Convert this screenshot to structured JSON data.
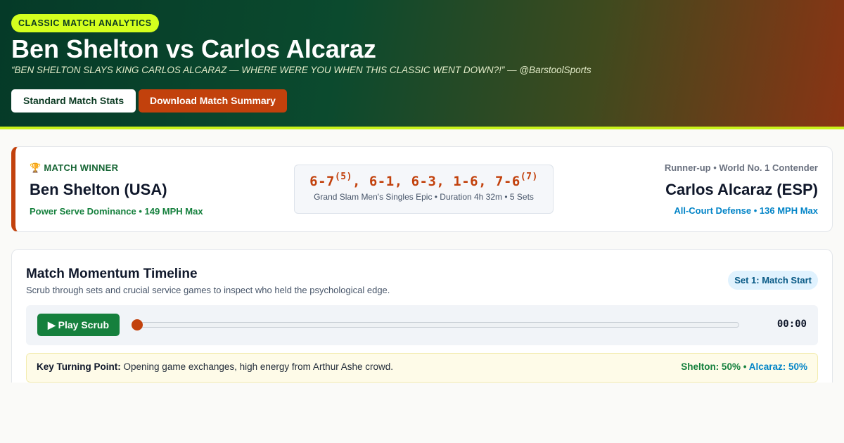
{
  "hero": {
    "badge": "CLASSIC MATCH ANALYTICS",
    "title": "Ben Shelton vs Carlos Alcaraz",
    "quote": "“BEN SHELTON SLAYS KING CARLOS ALCARAZ — WHERE WERE YOU WHEN THIS CLASSIC WENT DOWN?!” — @BarstoolSports",
    "standard_button": "Standard Match Stats",
    "download_button": "Download Match Summary"
  },
  "result": {
    "winner_tag": "🏆 MATCH WINNER",
    "winner_name": "Ben Shelton (USA)",
    "winner_note": "Power Serve Dominance • 149 MPH Max",
    "score_sets": [
      {
        "games": "6-7",
        "tiebreak": "(5)"
      },
      {
        "games": "6-1",
        "tiebreak": ""
      },
      {
        "games": "6-3",
        "tiebreak": ""
      },
      {
        "games": "1-6",
        "tiebreak": ""
      },
      {
        "games": "7-6",
        "tiebreak": "(7)"
      }
    ],
    "score_meta": "Grand Slam Men's Singles Epic • Duration 4h 32m • 5 Sets",
    "runner_tag": "Runner-up • World No. 1 Contender",
    "runner_name": "Carlos Alcaraz (ESP)",
    "runner_note": "All-Court Defense • 136 MPH Max"
  },
  "timeline": {
    "title": "Match Momentum Timeline",
    "subtitle": "Scrub through sets and crucial service games to inspect who held the psychological edge.",
    "set_badge": "Set 1: Match Start",
    "play_button": "▶ Play Scrub",
    "scrub_value": 0,
    "time": "00:00",
    "turning_label": "Key Turning Point:",
    "turning_text": "Opening game exchanges, high energy from Arthur Ashe crowd.",
    "shelton_pct": "Shelton: 50%",
    "separator": "•",
    "alcaraz_pct": "Alcaraz: 50%"
  },
  "colors": {
    "accent_lime": "#d4ff1e",
    "accent_orange": "#c2410c",
    "shelton_green": "#15803d",
    "alcaraz_blue": "#0284c7"
  }
}
